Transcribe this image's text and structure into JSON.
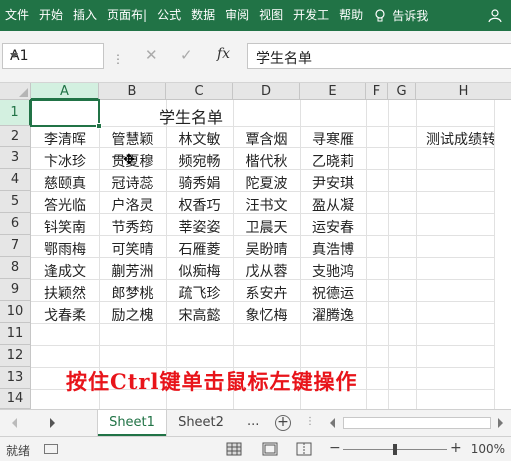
{
  "ribbon": {
    "tabs": [
      "文件",
      "开始",
      "插入",
      "页面布|",
      "公式",
      "数据",
      "审阅",
      "视图",
      "开发工",
      "帮助"
    ],
    "tell_me": "告诉我"
  },
  "formula_bar": {
    "name_box": "A1",
    "formula": "学生名单",
    "fx": "fx"
  },
  "columns": [
    "A",
    "B",
    "C",
    "D",
    "E",
    "F",
    "G",
    "H"
  ],
  "rows": [
    "1",
    "2",
    "3",
    "4",
    "5",
    "6",
    "7",
    "8",
    "9",
    "10",
    "11",
    "12",
    "13",
    "14"
  ],
  "title": "学生名单",
  "names": [
    [
      "李清晖",
      "管慧颖",
      "林文敏",
      "覃含烟",
      "寻寒雁"
    ],
    [
      "卞冰珍",
      "贯夏穆",
      "频宛畅",
      "楷代秋",
      "乙晓莉"
    ],
    [
      "慈颐真",
      "冠诗蕊",
      "骑秀娟",
      "陀夏波",
      "尹安琪"
    ],
    [
      "答光临",
      "户洛灵",
      "权香巧",
      "汪书文",
      "盈从凝"
    ],
    [
      "钭笑南",
      "节秀筠",
      "莘姿姿",
      "卫晨天",
      "运安春"
    ],
    [
      "鄂雨梅",
      "可笑晴",
      "石雁菱",
      "吴盼晴",
      "真浩博"
    ],
    [
      "逢成文",
      "蒯芳洲",
      "似痴梅",
      "戊从蓉",
      "支驰鸿"
    ],
    [
      "扶颖然",
      "郎梦桃",
      "疏飞珍",
      "系安卉",
      "祝德运"
    ],
    [
      "戈春柔",
      "励之槐",
      "宋高懿",
      "象忆梅",
      "濯腾逸"
    ]
  ],
  "h_label": "测试成绩转",
  "overlay_text": "按住Ctrl键单击鼠标左键操作",
  "sheets": [
    "Sheet1",
    "Sheet2"
  ],
  "sheet_more": "...",
  "status": {
    "ready": "就绪",
    "zoom": "100%"
  },
  "colors": {
    "accent": "#217346",
    "overlay": "#e8141a"
  }
}
